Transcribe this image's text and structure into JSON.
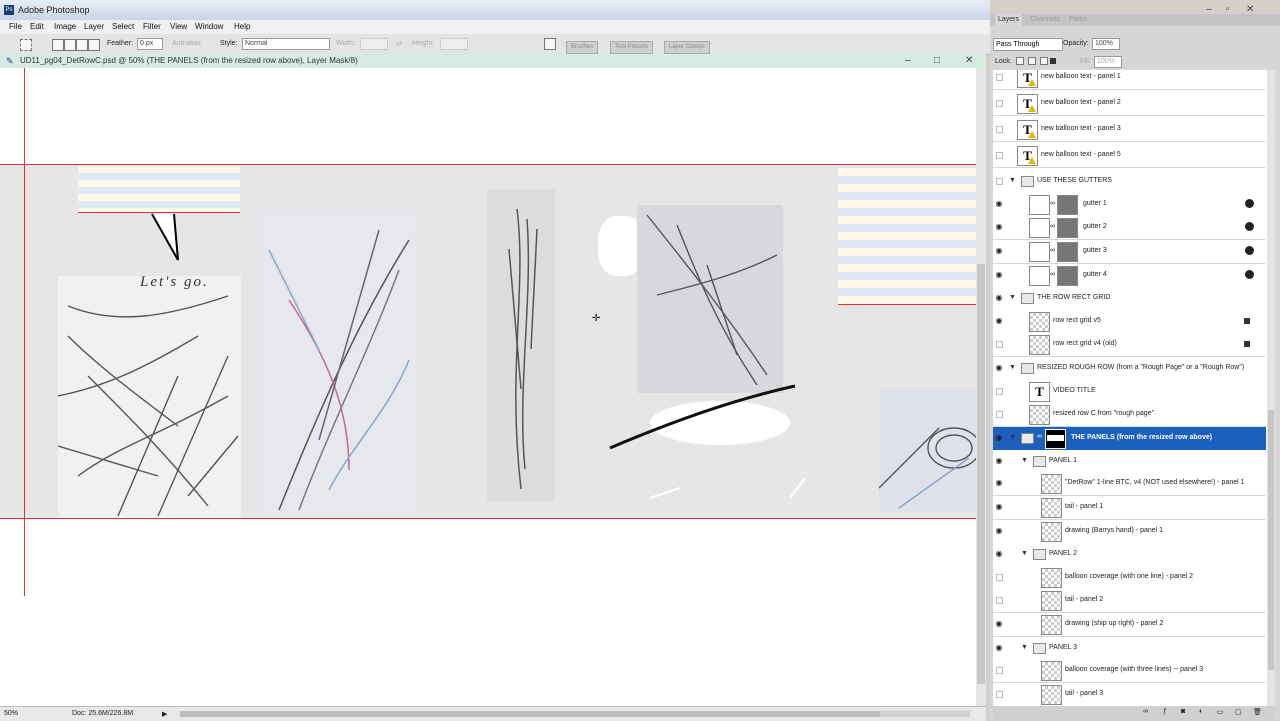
{
  "app": {
    "title": "Adobe Photoshop"
  },
  "menu": [
    "File",
    "Edit",
    "Image",
    "Layer",
    "Select",
    "Filter",
    "View",
    "Window",
    "Help"
  ],
  "options": {
    "feather_label": "Feather:",
    "feather_value": "0 px",
    "antialias_label": "Anti-alias",
    "style_label": "Style:",
    "style_value": "Normal",
    "width_label": "Width:",
    "height_label": "Height:",
    "palette_tabs": [
      "Brushes",
      "Tool Presets",
      "Layer Comps"
    ]
  },
  "document": {
    "title": "UD11_pg04_DetRowC.psd @ 50% (THE PANELS (from the resized row above), Layer Mask/8)",
    "canvas_text": "Let's go."
  },
  "status": {
    "zoom": "50%",
    "doc": "Doc: 25.6M/226.8M"
  },
  "panel": {
    "tabs": [
      "Layers",
      "Channels",
      "Paths"
    ],
    "blend_mode": "Pass Through",
    "opacity_label": "Opacity:",
    "opacity_value": "100%",
    "lock_label": "Lock:",
    "fill_label": "Fill:",
    "fill_value": "100%"
  },
  "layers": [
    {
      "name": "new balloon text - panel 1",
      "kind": "text",
      "warn": true,
      "indent": 0,
      "eye": false
    },
    {
      "name": "new balloon text - panel 2",
      "kind": "text",
      "warn": true,
      "indent": 0,
      "eye": false
    },
    {
      "name": "new balloon text - panel 3",
      "kind": "text",
      "warn": true,
      "indent": 0,
      "eye": false
    },
    {
      "name": "new balloon text - panel 5",
      "kind": "text",
      "warn": true,
      "indent": 0,
      "eye": false
    },
    {
      "name": "USE THESE GUTTERS",
      "kind": "group",
      "indent": 0,
      "eye": false
    },
    {
      "name": "gutter 1",
      "kind": "masked",
      "indent": 1,
      "eye": true,
      "fx": true
    },
    {
      "name": "gutter 2",
      "kind": "masked",
      "indent": 1,
      "eye": true,
      "fx": true
    },
    {
      "name": "gutter 3",
      "kind": "masked",
      "indent": 1,
      "eye": true,
      "fx": true
    },
    {
      "name": "gutter 4",
      "kind": "masked",
      "indent": 1,
      "eye": true,
      "fx": true
    },
    {
      "name": "THE ROW RECT GRID",
      "kind": "group",
      "indent": 0,
      "eye": true
    },
    {
      "name": "row rect grid v5",
      "kind": "pixel",
      "indent": 1,
      "eye": true,
      "lock": true
    },
    {
      "name": "row rect grid v4 (old)",
      "kind": "pixel",
      "indent": 1,
      "eye": false,
      "lock": true
    },
    {
      "name": "RESIZED ROUGH ROW (from a \"Rough Page\" or a \"Rough Row\")",
      "kind": "group",
      "indent": 0,
      "eye": true
    },
    {
      "name": "VIDEO TITLE",
      "kind": "text",
      "indent": 1,
      "eye": false
    },
    {
      "name": "resized row C from \"rough page\"",
      "kind": "pixel",
      "indent": 1,
      "eye": false
    },
    {
      "name": "THE PANELS (from the resized row above)",
      "kind": "group-mask",
      "indent": 0,
      "eye": true,
      "selected": true
    },
    {
      "name": "PANEL 1",
      "kind": "group",
      "indent": 1,
      "eye": true
    },
    {
      "name": "\"DetRow\" 1-line BTC, v4 (NOT used elsewhere!) - panel 1",
      "kind": "pixel",
      "indent": 2,
      "eye": true
    },
    {
      "name": "tail - panel 1",
      "kind": "pixel",
      "indent": 2,
      "eye": true
    },
    {
      "name": "drawing (Barrys hand) - panel 1",
      "kind": "pixel",
      "indent": 2,
      "eye": true
    },
    {
      "name": "PANEL 2",
      "kind": "group",
      "indent": 1,
      "eye": true
    },
    {
      "name": "balloon coverage (with one line) - panel 2",
      "kind": "pixel",
      "indent": 2,
      "eye": false
    },
    {
      "name": "tail - panel 2",
      "kind": "pixel",
      "indent": 2,
      "eye": false
    },
    {
      "name": "drawing (ship up right) - panel 2",
      "kind": "pixel",
      "indent": 2,
      "eye": true
    },
    {
      "name": "PANEL 3",
      "kind": "group",
      "indent": 1,
      "eye": true
    },
    {
      "name": "balloon coverage (with three lines) -- panel 3",
      "kind": "pixel",
      "indent": 2,
      "eye": false
    },
    {
      "name": "tail - panel 3",
      "kind": "pixel",
      "indent": 2,
      "eye": false
    }
  ]
}
